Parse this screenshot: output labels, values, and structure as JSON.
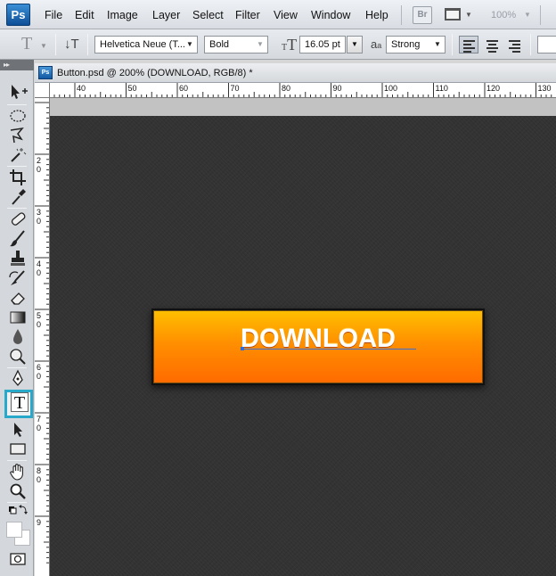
{
  "app": {
    "logo": "Ps"
  },
  "menu": {
    "items": [
      "File",
      "Edit",
      "Image",
      "Layer",
      "Select",
      "Filter",
      "View",
      "Window",
      "Help"
    ],
    "bridge_label": "Br",
    "zoom_value": "100%"
  },
  "options": {
    "font_family": "Helvetica Neue (T...",
    "font_style": "Bold",
    "font_size": "16.05 pt",
    "anti_alias_label": "a",
    "anti_alias_sub": "a",
    "anti_alias": "Strong",
    "orientation_glyph": "T"
  },
  "tools": {
    "panel_header": "▸▸",
    "active_tool": "T",
    "highlight_color": "#29a9c9"
  },
  "document": {
    "tab_icon": "Ps",
    "title": "Button.psd @ 200% (DOWNLOAD, RGB/8) *",
    "ruler_h_labels": [
      "40",
      "50",
      "60",
      "70",
      "80",
      "90",
      "100",
      "110",
      "120",
      "130"
    ],
    "ruler_v_labels": [
      "2\n0",
      "3\n0",
      "4\n0",
      "5\n0",
      "6\n0",
      "7\n0",
      "8\n0",
      "9"
    ],
    "button_text": "DOWNLOAD",
    "button_gradient_top": "#ffc000",
    "button_gradient_bottom": "#ff6a00",
    "canvas_color": "#333333"
  }
}
